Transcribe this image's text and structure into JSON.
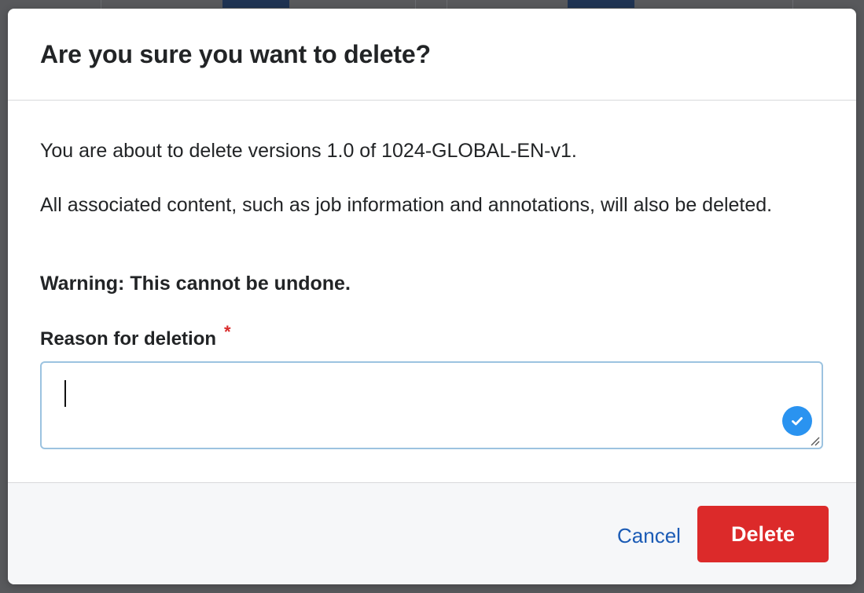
{
  "dialog": {
    "title": "Are you sure you want to delete?",
    "message": "You are about to delete versions 1.0 of 1024-GLOBAL-EN-v1.",
    "detail": "All associated content, such as job information and annotations, will also be deleted.",
    "warning": "Warning: This cannot be undone.",
    "reason_field": {
      "label": "Reason for deletion",
      "required_marker": "*",
      "value": "",
      "placeholder": ""
    },
    "cancel_label": "Cancel",
    "delete_label": "Delete"
  },
  "colors": {
    "overlay": "#58595c",
    "danger": "#dc2a2a",
    "link": "#1b5bb5",
    "focus_border": "#9cc3e0",
    "badge": "#2a93f0"
  },
  "icons": {
    "badge": "checkmark-icon",
    "resize": "resize-grip-icon"
  }
}
